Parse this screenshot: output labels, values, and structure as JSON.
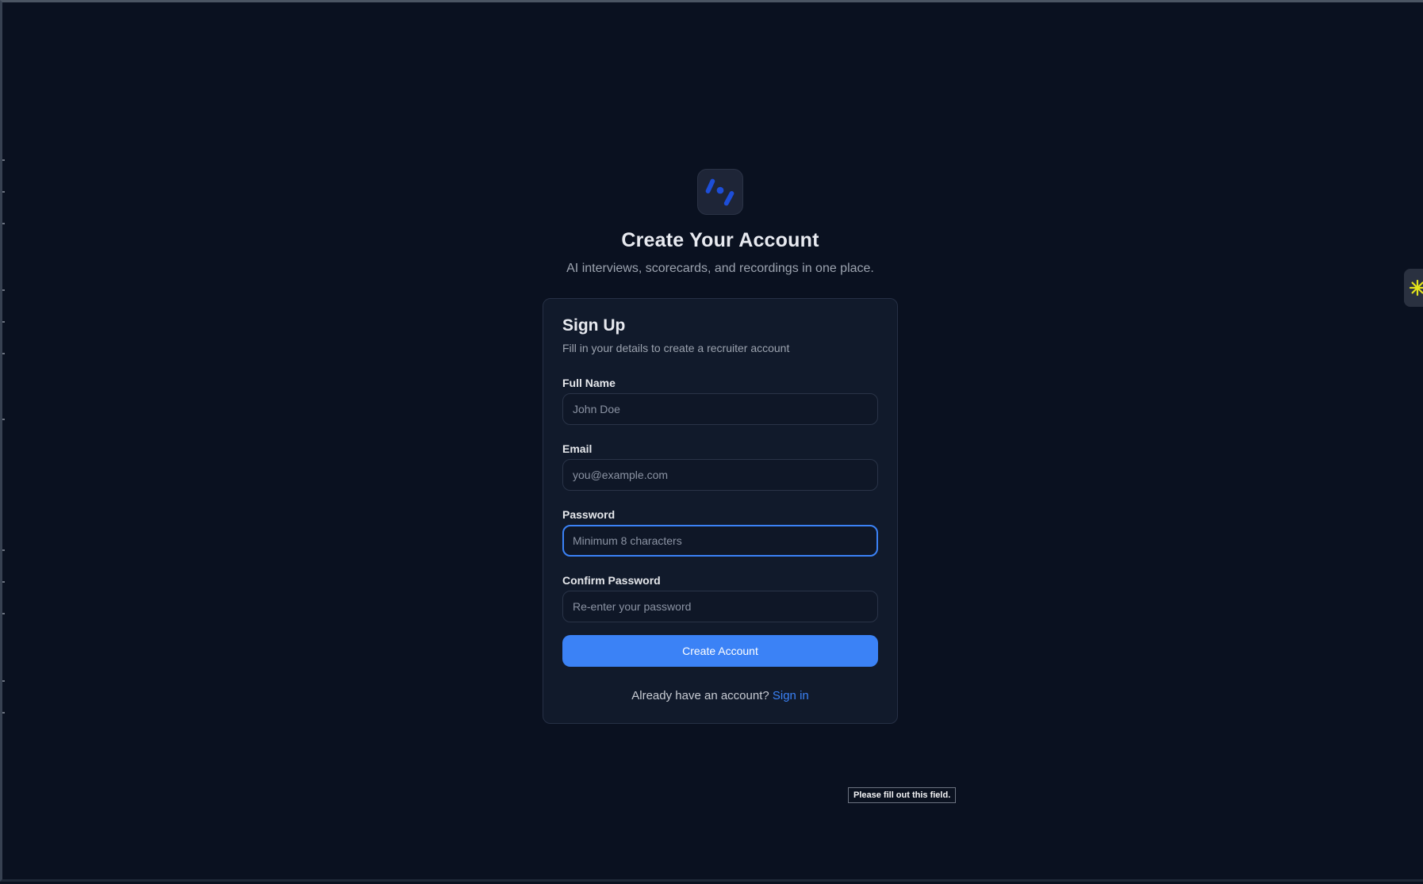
{
  "header": {
    "title": "Create Your Account",
    "subtitle": "AI interviews, scorecards, and recordings in one place."
  },
  "card": {
    "title": "Sign Up",
    "subtitle": "Fill in your details to create a recruiter account",
    "fields": {
      "full_name": {
        "label": "Full Name",
        "placeholder": "John Doe",
        "value": ""
      },
      "email": {
        "label": "Email",
        "placeholder": "you@example.com",
        "value": ""
      },
      "password": {
        "label": "Password",
        "placeholder": "Minimum 8 characters",
        "value": ""
      },
      "confirm_password": {
        "label": "Confirm Password",
        "placeholder": "Re-enter your password",
        "value": ""
      }
    },
    "submit_label": "Create Account",
    "footer_text": "Already have an account?",
    "footer_link": "Sign in"
  },
  "validation_tooltip": "Please fill out this field.",
  "colors": {
    "background": "#0a1120",
    "card": "#111a2b",
    "accent": "#3b82f6",
    "logo_mark": "#1d4ed8",
    "widget_icon": "#e3e31b"
  },
  "icons": {
    "logo": "brand-logo-icon",
    "side_widget": "asterisk-icon"
  }
}
